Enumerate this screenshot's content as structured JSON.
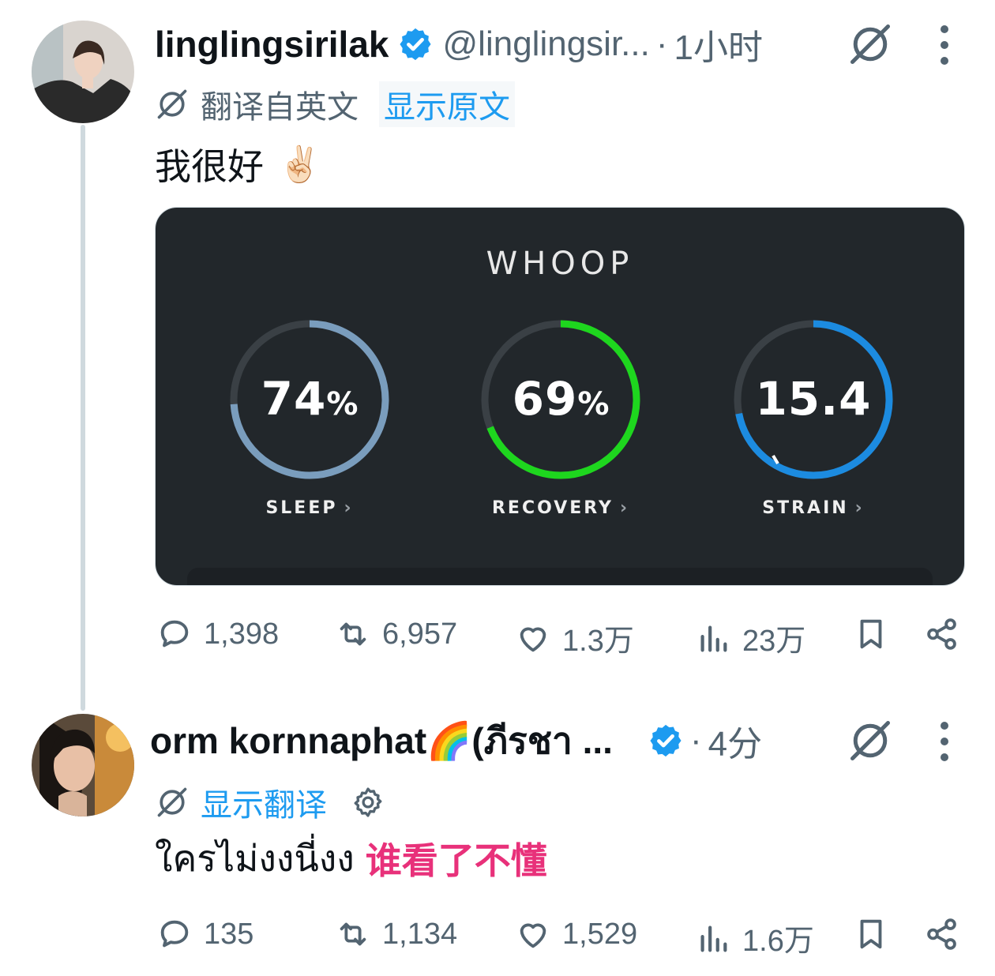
{
  "tweet1": {
    "name": "linglingsirilak",
    "handle": "@linglingsir...",
    "dot": "·",
    "time": "1小时",
    "translated_from": "翻译自英文",
    "show_original": "显示原文",
    "text": "我很好",
    "emoji": "✌🏻",
    "card": {
      "brand": "WHOOP",
      "metrics": [
        {
          "label": "SLEEP",
          "value": "74",
          "unit": "%",
          "progress": 0.74,
          "color": "#7a9dbd"
        },
        {
          "label": "RECOVERY",
          "value": "69",
          "unit": "%",
          "progress": 0.69,
          "color": "#1ed61e"
        },
        {
          "label": "STRAIN",
          "value": "15.4",
          "unit": "",
          "progress": 0.72,
          "color": "#1c8be0"
        }
      ],
      "chevron": "›"
    },
    "actions": {
      "replies": "1,398",
      "reposts": "6,957",
      "likes": "1.3万",
      "views": "23万"
    }
  },
  "tweet2": {
    "name": "orm kornnaphat🌈(ภีรชา ...",
    "dot": "·",
    "time": "4分",
    "show_translation": "显示翻译",
    "text": "ใครไม่งงนี่งง",
    "annotation": "谁看了不懂",
    "actions": {
      "replies": "135",
      "reposts": "1,134",
      "likes": "1,529",
      "views": "1.6万"
    }
  },
  "colors": {
    "accent": "#1d9bf0",
    "secondary_text": "#536471",
    "highlight": "#e8317a",
    "card_bg": "#22272b"
  }
}
